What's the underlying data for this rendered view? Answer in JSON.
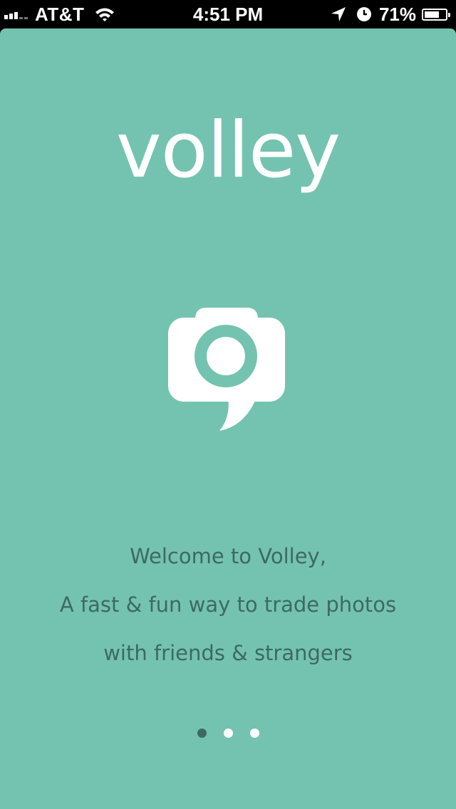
{
  "status_bar": {
    "carrier": "AT&T",
    "time": "4:51 PM",
    "battery_percent": "71%",
    "battery_level": 0.71,
    "icons": [
      "signal-bars-icon",
      "wifi-icon",
      "location-arrow-icon",
      "alarm-clock-icon",
      "battery-icon"
    ]
  },
  "app": {
    "title": "volley",
    "logo_icon": "camera-speech-bubble-icon",
    "background_color": "#74c3b0",
    "text_color": "#3d6a60"
  },
  "welcome": {
    "line1": "Welcome to Volley,",
    "line2": "A fast & fun way to trade photos",
    "line3": "with friends & strangers"
  },
  "pagination": {
    "total": 3,
    "current": 1
  }
}
